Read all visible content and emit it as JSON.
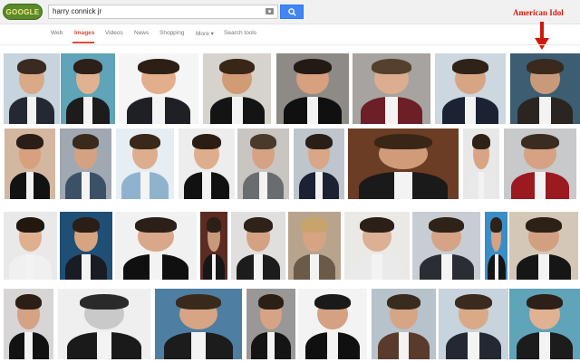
{
  "header": {
    "logo_text": "GOOGLE",
    "search_value": "harry connick jr"
  },
  "annotation": {
    "label": "American Idol",
    "color": "#d1170c"
  },
  "tabs": [
    {
      "label": "Web",
      "active": false
    },
    {
      "label": "Images",
      "active": true
    },
    {
      "label": "Videos",
      "active": false
    },
    {
      "label": "News",
      "active": false
    },
    {
      "label": "Shopping",
      "active": false
    },
    {
      "label": "More ▾",
      "active": false
    },
    {
      "label": "Search tools",
      "active": false
    }
  ],
  "colors": {
    "accent_tab": "#dd4b39",
    "search_button": "#4285f4"
  },
  "images": [
    {
      "bg": "#c7d3dd",
      "skin": "#d9a988",
      "hair": "#3b2a1f",
      "coat": "#232832"
    },
    {
      "bg": "#5fa4b8",
      "skin": "#e0b292",
      "hair": "#2c2018",
      "coat": "#1c1c1c"
    },
    {
      "bg": "#f5f5f5",
      "skin": "#e2ae8c",
      "hair": "#2d1f16",
      "coat": "#1f1f26"
    },
    {
      "bg": "#d6d2cc",
      "skin": "#d19b75",
      "hair": "#3a2616",
      "coat": "#141414"
    },
    {
      "bg": "#8e8b86",
      "skin": "#d7a07e",
      "hair": "#231a13",
      "coat": "#101010"
    },
    {
      "bg": "#a7a3a0",
      "skin": "#dcae8f",
      "hair": "#55402e",
      "coat": "#6c1f27"
    },
    {
      "bg": "#cdd7df",
      "skin": "#d7a584",
      "hair": "#2f2219",
      "coat": "#1a2234"
    },
    {
      "bg": "#3d5d73",
      "skin": "#c99a7a",
      "hair": "#3a2a1e",
      "coat": "#2a2520"
    },
    {
      "bg": "#d3b7a0",
      "skin": "#d8a07e",
      "hair": "#2b1e16",
      "coat": "#121212"
    },
    {
      "bg": "#a0a8b2",
      "skin": "#d4a283",
      "hair": "#3a2a1c",
      "coat": "#3c5068"
    },
    {
      "bg": "#e7eef3",
      "skin": "#ddae8e",
      "hair": "#3a2818",
      "coat": "#8fb3cc"
    },
    {
      "bg": "#ededed",
      "skin": "#deae8c",
      "hair": "#2a1d14",
      "coat": "#111111"
    },
    {
      "bg": "#c9c6c2",
      "skin": "#d5a383",
      "hair": "#4a3a2c",
      "coat": "#6a6d70"
    },
    {
      "bg": "#bfc5cc",
      "skin": "#d9a687",
      "hair": "#2a1f18",
      "coat": "#1c2233"
    },
    {
      "bg": "#6b3d24",
      "skin": "#d19b79",
      "hair": "#3a2617",
      "coat": "#1a1a1a"
    },
    {
      "bg": "#e8e8e8",
      "skin": "#d8a484",
      "hair": "#2e2218",
      "coat": "#e9e9e9"
    },
    {
      "bg": "#c7c9cb",
      "skin": "#d6a283",
      "hair": "#3b2c21",
      "coat": "#9a1a20"
    },
    {
      "bg": "#eae9ea",
      "skin": "#dfb090",
      "hair": "#23180f",
      "coat": "#f0f0f0"
    },
    {
      "bg": "#1f4f74",
      "skin": "#d7a482",
      "hair": "#2a1e16",
      "coat": "#191c22"
    },
    {
      "bg": "#f1f1f1",
      "skin": "#d9a789",
      "hair": "#2b1f17",
      "coat": "#101010"
    },
    {
      "bg": "#5b2b24",
      "skin": "#c99a7a",
      "hair": "#2c1f16",
      "coat": "#161616"
    },
    {
      "bg": "#e0dfde",
      "skin": "#d4a282",
      "hair": "#2e2219",
      "coat": "#1c1c1c"
    },
    {
      "bg": "#b8a48d",
      "skin": "#d6a383",
      "hair": "#c7a46b",
      "coat": "#6b5a48"
    },
    {
      "bg": "#ebe9e6",
      "skin": "#dcb095",
      "hair": "#2c1f17",
      "coat": "#eaeaea"
    },
    {
      "bg": "#c8cdd3",
      "skin": "#d5a385",
      "hair": "#2f2218",
      "coat": "#2a2d33"
    },
    {
      "bg": "#3a8ec7",
      "skin": "#d6a283",
      "hair": "#2e2218",
      "coat": "#151515"
    },
    {
      "bg": "#d5c7b8",
      "skin": "#d2a081",
      "hair": "#2d2016",
      "coat": "#161616"
    },
    {
      "bg": "#d7d5d6",
      "skin": "#d5a283",
      "hair": "#2c1f17",
      "coat": "#121212"
    },
    {
      "bg": "#efefef",
      "skin": "#c9c9c9",
      "hair": "#2a2a2a",
      "coat": "#1a1a1a"
    },
    {
      "bg": "#4e7fa2",
      "skin": "#d7a585",
      "hair": "#3a2a1c",
      "coat": "#1c1c1c"
    },
    {
      "bg": "#9a9896",
      "skin": "#d6a485",
      "hair": "#2b1f16",
      "coat": "#141414"
    },
    {
      "bg": "#f3f3f3",
      "skin": "#d4a283",
      "hair": "#1a1a1a",
      "coat": "#101010"
    },
    {
      "bg": "#b7c2cb",
      "skin": "#d6a586",
      "hair": "#3a2b1f",
      "coat": "#5a3a2a"
    }
  ]
}
